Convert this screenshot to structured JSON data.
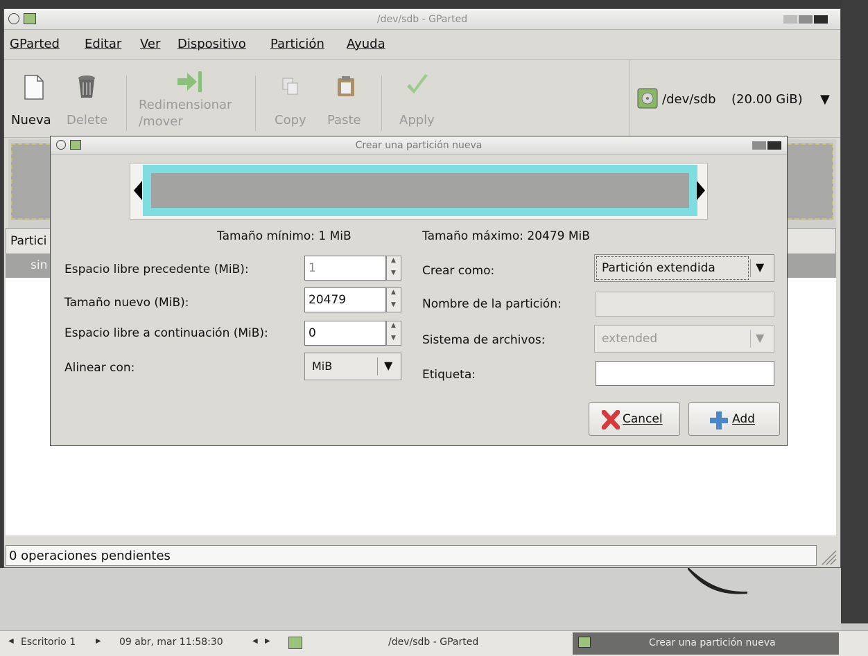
{
  "main_window": {
    "title": "/dev/sdb - GParted",
    "menu": [
      "GParted",
      "Editar",
      "Ver",
      "Dispositivo",
      "Partición",
      "Ayuda"
    ],
    "toolbar": {
      "new": "Nueva",
      "delete": "Delete",
      "resize_line1": "Redimensionar",
      "resize_line2": "/mover",
      "copy": "Copy",
      "paste": "Paste",
      "apply": "Apply"
    },
    "device": {
      "name": "/dev/sdb",
      "size": "(20.00 GiB)"
    },
    "list": {
      "header_partial": "Partici",
      "row_partial": "sin"
    },
    "status": "0 operaciones pendientes"
  },
  "dialog": {
    "title": "Crear una partición nueva",
    "min_size": "Tamaño mínimo: 1 MiB",
    "max_size": "Tamaño máximo: 20479 MiB",
    "labels": {
      "free_before": "Espacio libre precedente (MiB):",
      "new_size": "Tamaño nuevo (MiB):",
      "free_after": "Espacio libre a continuación (MiB):",
      "align": "Alinear con:",
      "create_as": "Crear como:",
      "partition_name": "Nombre de la partición:",
      "filesystem": "Sistema de archivos:",
      "label": "Etiqueta:"
    },
    "values": {
      "free_before": "1",
      "new_size": "20479",
      "free_after": "0",
      "align": "MiB",
      "create_as": "Partición extendida",
      "partition_name": "",
      "filesystem": "extended",
      "label": ""
    },
    "buttons": {
      "cancel": "Cancel",
      "add": "Add"
    },
    "colors": {
      "partition_frame": "#7fdde0",
      "partition_fill": "#a3a3a1"
    }
  },
  "taskbar": {
    "workspace": "Escritorio 1",
    "clock": "09 abr, mar 11:58:30",
    "task1": "/dev/sdb - GParted",
    "task2": "Crear una partición nueva"
  }
}
